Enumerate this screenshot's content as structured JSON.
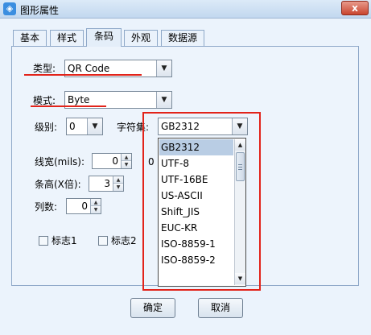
{
  "window": {
    "title": "图形属性",
    "close_label": "x"
  },
  "tabs": [
    {
      "label": "基本"
    },
    {
      "label": "样式"
    },
    {
      "label": "条码",
      "active": true
    },
    {
      "label": "外观"
    },
    {
      "label": "数据源"
    }
  ],
  "form": {
    "type_label": "类型:",
    "type_value": "QR Code",
    "mode_label": "模式:",
    "mode_value": "Byte",
    "level_label": "级别:",
    "level_value": "0",
    "charset_label": "字符集:",
    "charset_value": "GB2312",
    "line_width_label": "线宽(mils):",
    "line_width_value": "0",
    "line_width_suffix": "0",
    "bar_height_label": "条高(X倍):",
    "bar_height_value": "3",
    "columns_label": "列数:",
    "columns_value": "0",
    "flag1_label": "标志1",
    "flag2_label": "标志2"
  },
  "charset_options": [
    "GB2312",
    "UTF-8",
    "UTF-16BE",
    "US-ASCII",
    "Shift_JIS",
    "EUC-KR",
    "ISO-8859-1",
    "ISO-8859-2"
  ],
  "buttons": {
    "ok": "确定",
    "cancel": "取消"
  },
  "colors": {
    "annotation_red": "#e2231a",
    "selected_bg": "#b9cde4",
    "dialog_bg": "#ebf3fc"
  },
  "icons": {
    "dropdown": "chevron-down-icon",
    "close": "close-icon",
    "app": "app-icon"
  }
}
